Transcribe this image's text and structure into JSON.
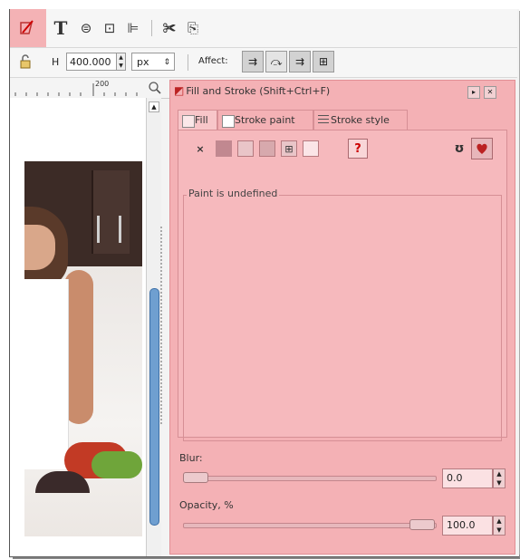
{
  "toolbar": {
    "tools": [
      {
        "name": "fill-stroke-tool-icon",
        "glyph": "◩"
      },
      {
        "name": "text-tool-icon",
        "glyph": "T"
      },
      {
        "name": "xml-editor-icon",
        "glyph": "⊜"
      },
      {
        "name": "layers-icon",
        "glyph": "⊡"
      },
      {
        "name": "align-icon",
        "glyph": "⊫"
      },
      {
        "name": "preferences-icon",
        "glyph": "✀"
      },
      {
        "name": "document-props-icon",
        "glyph": "⎘"
      }
    ]
  },
  "controls": {
    "h_label": "H",
    "h_value": "400.000",
    "unit": "px",
    "affect_label": "Affect:"
  },
  "ruler": {
    "tick_label": "200"
  },
  "dialog": {
    "title": "Fill and Stroke (Shift+Ctrl+F)",
    "tabs": [
      "Fill",
      "Stroke paint",
      "Stroke style"
    ],
    "no_paint_glyph": "×",
    "unknown_glyph": "?",
    "paint_status": "Paint is undefined",
    "blur_label": "Blur:",
    "blur_value": "0.0",
    "blur_fraction": 0.0,
    "opacity_label": "Opacity, %",
    "opacity_value": "100.0",
    "opacity_fraction": 1.0,
    "highlight_color": "#f4b1b5"
  }
}
